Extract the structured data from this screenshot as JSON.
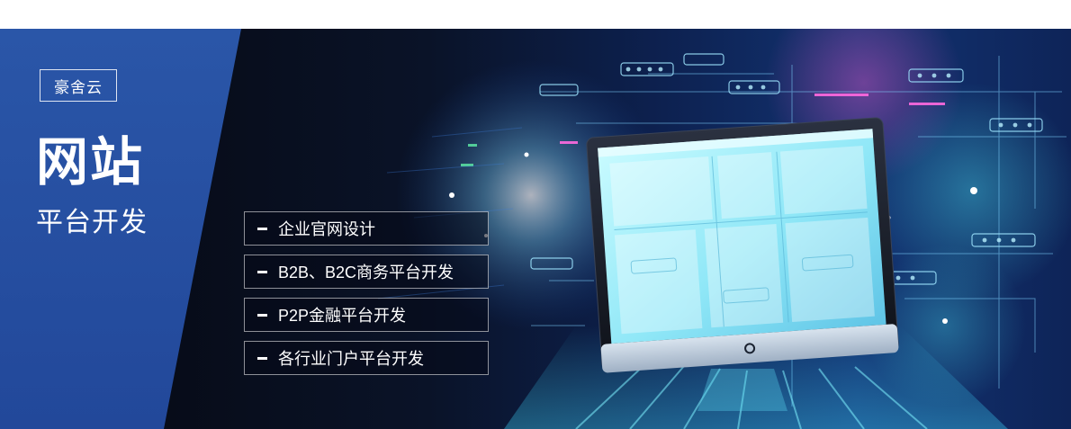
{
  "brand": {
    "name": "豪舍云"
  },
  "hero": {
    "title": "网站",
    "subtitle": "平台开发"
  },
  "services": {
    "items": [
      {
        "label": "企业官网设计"
      },
      {
        "label": "B2B、B2C商务平台开发"
      },
      {
        "label": "P2P金融平台开发"
      },
      {
        "label": "各行业门户平台开发"
      }
    ]
  },
  "colors": {
    "panel_blue": "#2a56a8",
    "accent_cyan": "#8fefff",
    "background_dark": "#05070f"
  },
  "icons": {
    "service_bullet": "dash-icon"
  }
}
